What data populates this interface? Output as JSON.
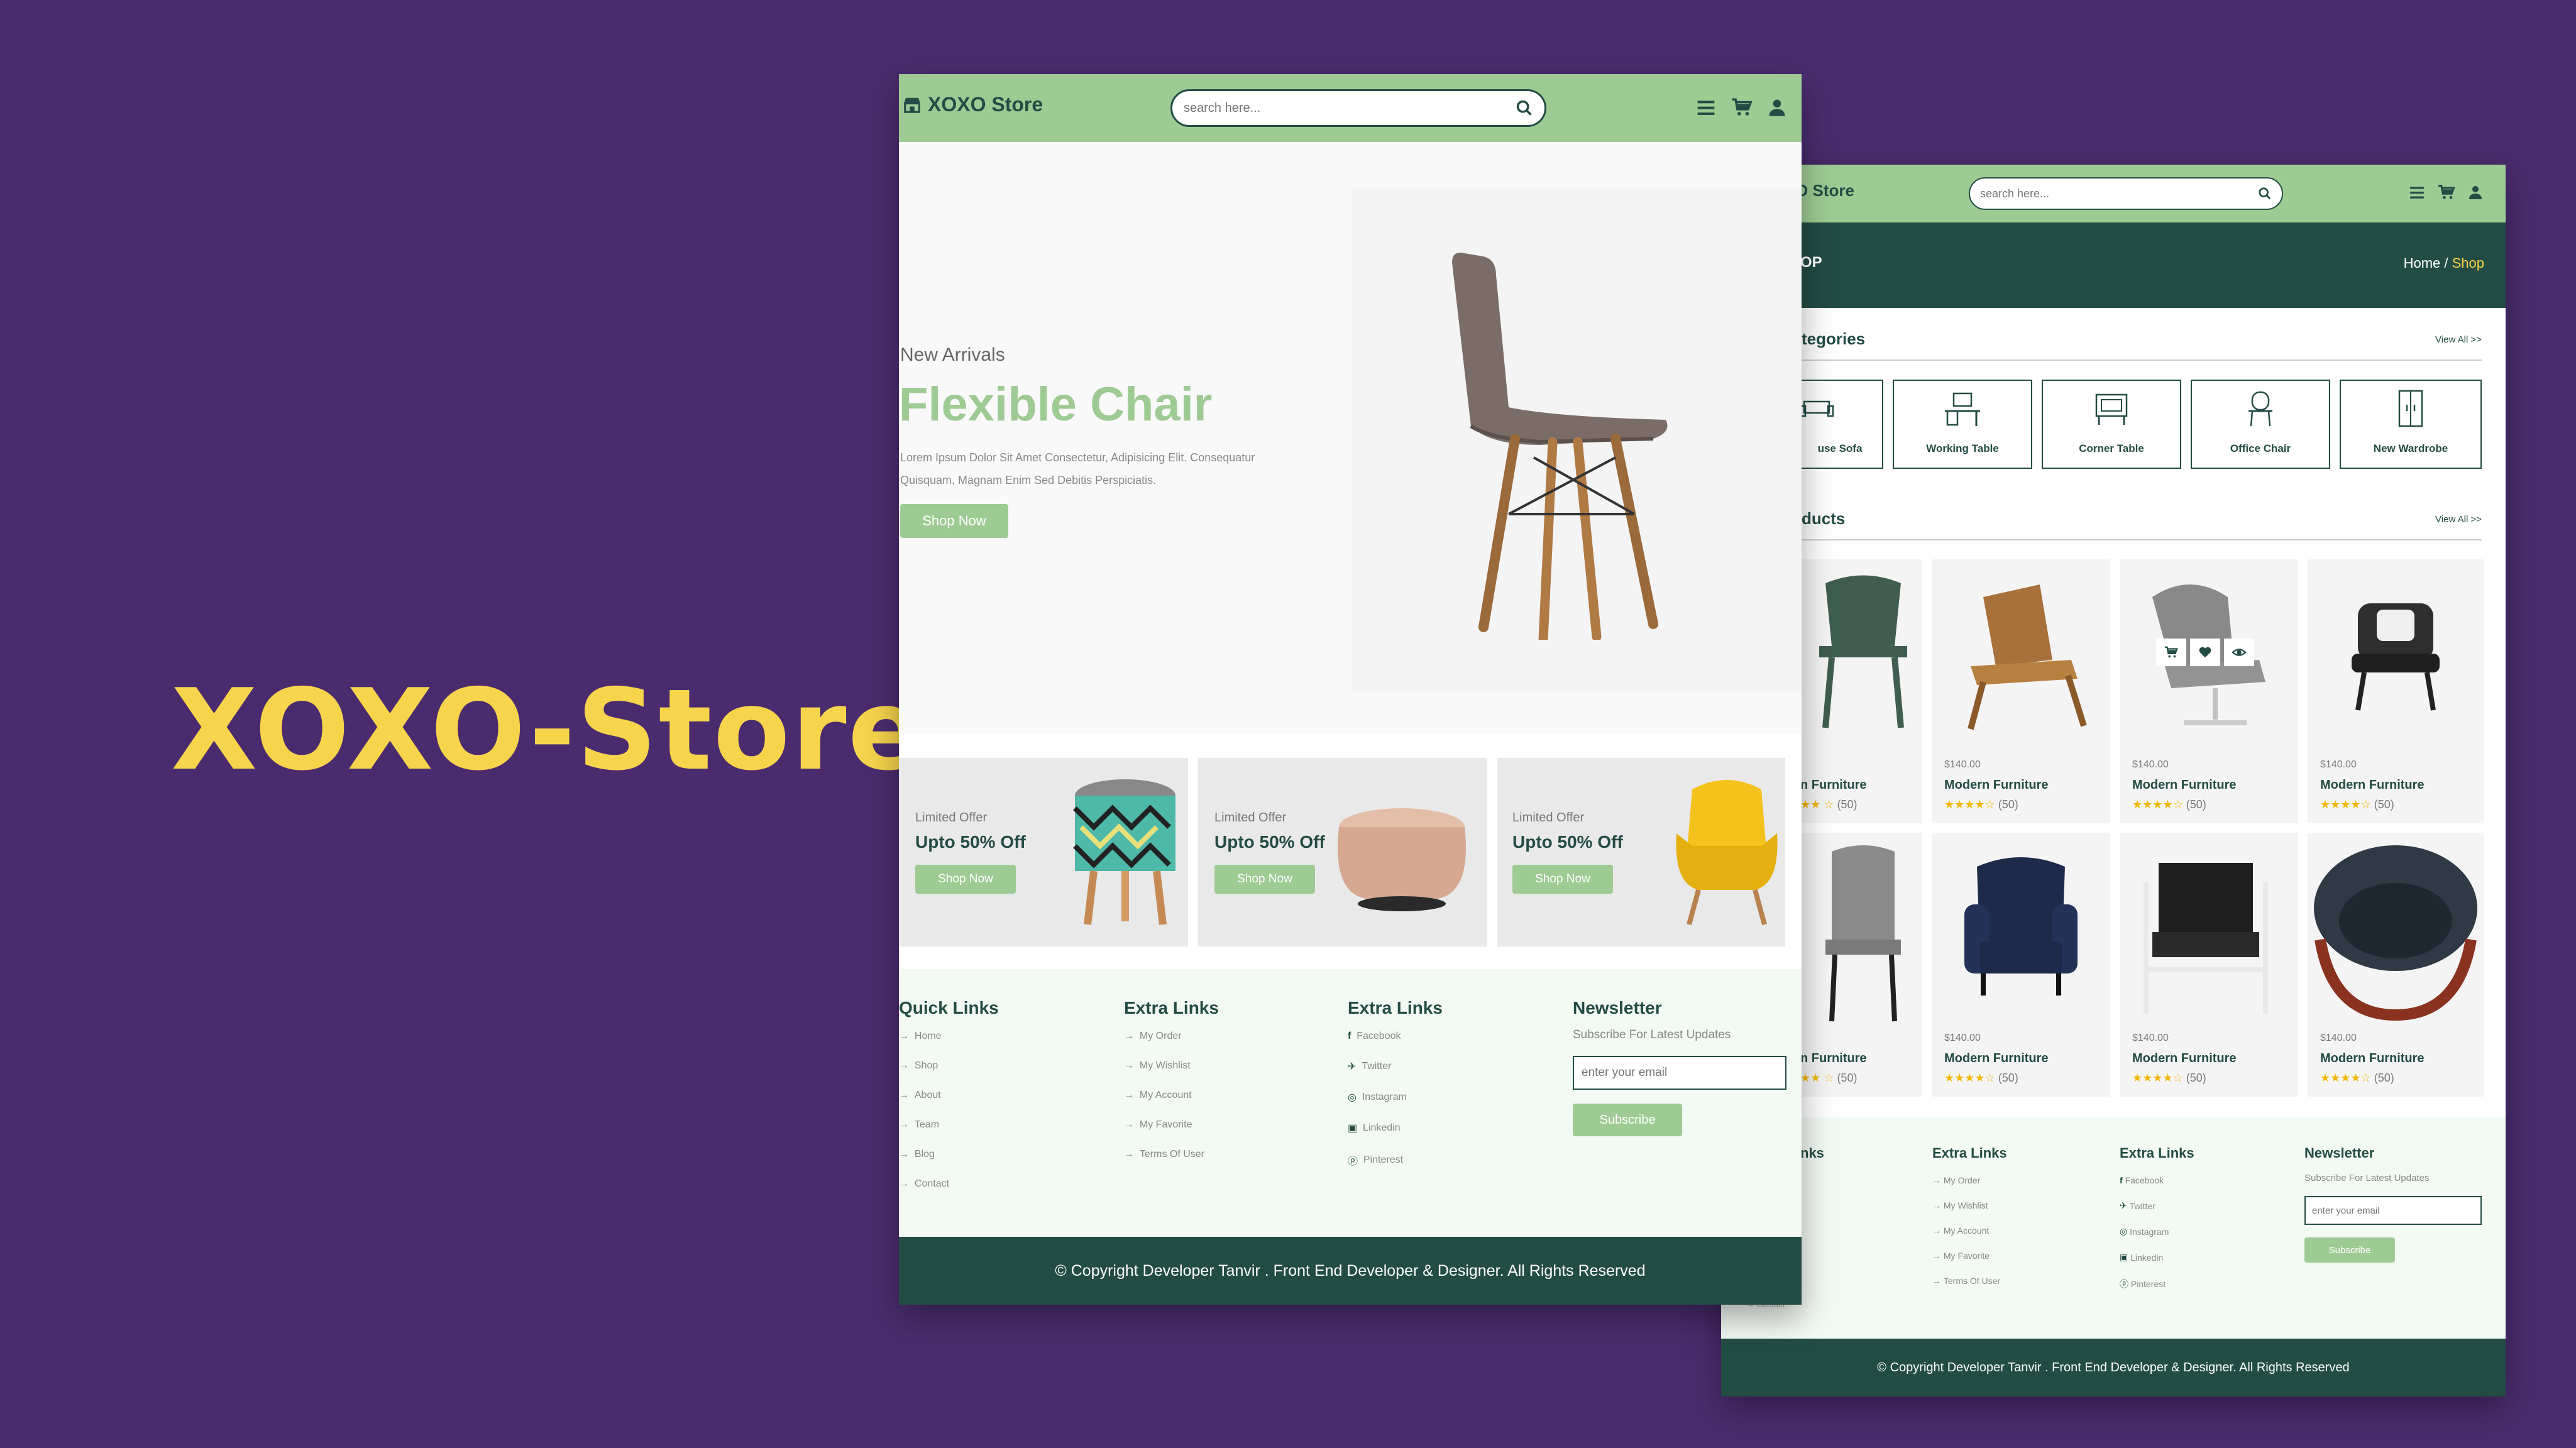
{
  "brand_title": "XOXO-Store",
  "colors": {
    "background": "#4a2c6e",
    "accent": "#9ecb94",
    "dark": "#234c44",
    "title": "#f6d44c",
    "star": "#f2b600"
  },
  "header": {
    "logo_text": "XOXO Store",
    "logo_icon": "store-icon",
    "search_placeholder": "search here...",
    "icons": [
      "menu-icon",
      "cart-icon",
      "user-icon"
    ]
  },
  "hero": {
    "subtitle": "New Arrivals",
    "title": "Flexible Chair",
    "description_line1": "Lorem Ipsum Dolor Sit Amet Consectetur, Adipisicing Elit. Consequatur",
    "description_line2": "Quisquam, Magnam Enim Sed Debitis Perspiciatis.",
    "button": "Shop Now"
  },
  "offers": [
    {
      "label": "Limited Offer",
      "title": "Upto 50% Off",
      "button": "Shop Now",
      "product": "patterned stool"
    },
    {
      "label": "Limited Offer",
      "title": "Upto 50% Off",
      "button": "Shop Now",
      "product": "pouf"
    },
    {
      "label": "Limited Offer",
      "title": "Upto 50% Off",
      "button": "Shop Now",
      "product": "yellow armchair"
    }
  ],
  "footer": {
    "quick_links": {
      "title": "Quick Links",
      "items": [
        "Home",
        "Shop",
        "About",
        "Team",
        "Blog",
        "Contact"
      ]
    },
    "extra_links": {
      "title": "Extra Links",
      "items": [
        "My Order",
        "My Wishlist",
        "My Account",
        "My Favorite",
        "Terms Of User"
      ]
    },
    "social_links": {
      "title": "Extra Links",
      "items": [
        "Facebook",
        "Twitter",
        "Instagram",
        "Linkedin",
        "Pinterest"
      ]
    },
    "newsletter": {
      "title": "Newsletter",
      "subtitle": "Subscribe For Latest Updates",
      "placeholder": "enter your email",
      "button": "Subscribe"
    },
    "copyright": "© Copyright Developer Tanvir . Front End Developer & Designer. All Rights Reserved"
  },
  "shop_page": {
    "logo_text_partial": "O Store",
    "banner_title_partial": "OP",
    "breadcrumb_home": "Home",
    "breadcrumb_sep": " / ",
    "breadcrumb_current": "Shop",
    "categories_title_partial": "tegories",
    "view_all": "View All >>",
    "categories": [
      {
        "label": "use Sofa",
        "icon": "sofa-icon"
      },
      {
        "label": "Working Table",
        "icon": "desk-icon"
      },
      {
        "label": "Corner Table",
        "icon": "corner-table-icon"
      },
      {
        "label": "Office Chair",
        "icon": "office-chair-icon"
      },
      {
        "label": "New Wardrobe",
        "icon": "wardrobe-icon"
      }
    ],
    "products_title_partial": "ducts",
    "products_row1": [
      {
        "price": "",
        "name": "n Furniture",
        "rating": "(50)"
      },
      {
        "price": "$140.00",
        "name": "Modern Furniture",
        "rating": "(50)"
      },
      {
        "price": "$140.00",
        "name": "Modern Furniture",
        "rating": "(50)"
      },
      {
        "price": "$140.00",
        "name": "Modern Furniture",
        "rating": "(50)"
      }
    ],
    "products_row2": [
      {
        "price": "",
        "name": "n Furniture",
        "rating": "(50)"
      },
      {
        "price": "$140.00",
        "name": "Modern Furniture",
        "rating": "(50)"
      },
      {
        "price": "$140.00",
        "name": "Modern Furniture",
        "rating": "(50)"
      },
      {
        "price": "$140.00",
        "name": "Modern Furniture",
        "rating": "(50)"
      }
    ],
    "footer_quick_partial": "nks",
    "footer_contact_partial": "Contact"
  }
}
